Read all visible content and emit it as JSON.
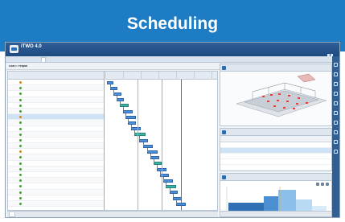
{
  "banner": {
    "title": "Scheduling",
    "color": "#1d7cc3"
  },
  "app": {
    "logo": "iTWO 4.0",
    "subtitle": "",
    "header_right": "",
    "ribbon_tabs": [
      "",
      "",
      "",
      "",
      "",
      "",
      "",
      ""
    ],
    "active_tab_index": 1
  },
  "gantt": {
    "title": "GANTT Fenpild",
    "columns": [
      "",
      "",
      "",
      "",
      ""
    ],
    "rows": [
      {
        "c1": "",
        "c2": "",
        "c3": "",
        "c4": ""
      },
      {
        "c1": "",
        "c2": "",
        "c3": "",
        "c4": ""
      },
      {
        "c1": "",
        "c2": "",
        "c3": "",
        "c4": ""
      },
      {
        "c1": "",
        "c2": "",
        "c3": "",
        "c4": ""
      },
      {
        "c1": "",
        "c2": "",
        "c3": "",
        "c4": ""
      },
      {
        "c1": "",
        "c2": "",
        "c3": "",
        "c4": ""
      },
      {
        "c1": "",
        "c2": "",
        "c3": "",
        "c4": ""
      },
      {
        "c1": "",
        "c2": "",
        "c3": "",
        "c4": ""
      },
      {
        "c1": "",
        "c2": "",
        "c3": "",
        "c4": ""
      },
      {
        "c1": "",
        "c2": "",
        "c3": "",
        "c4": ""
      },
      {
        "c1": "",
        "c2": "",
        "c3": "",
        "c4": ""
      },
      {
        "c1": "",
        "c2": "",
        "c3": "",
        "c4": ""
      },
      {
        "c1": "",
        "c2": "",
        "c3": "",
        "c4": ""
      },
      {
        "c1": "",
        "c2": "",
        "c3": "",
        "c4": ""
      },
      {
        "c1": "",
        "c2": "",
        "c3": "",
        "c4": ""
      },
      {
        "c1": "",
        "c2": "",
        "c3": "",
        "c4": ""
      },
      {
        "c1": "",
        "c2": "",
        "c3": "",
        "c4": ""
      },
      {
        "c1": "",
        "c2": "",
        "c3": "",
        "c4": ""
      },
      {
        "c1": "",
        "c2": "",
        "c3": "",
        "c4": ""
      },
      {
        "c1": "",
        "c2": "",
        "c3": "",
        "c4": ""
      },
      {
        "c1": "",
        "c2": "",
        "c3": "",
        "c4": ""
      },
      {
        "c1": "",
        "c2": "",
        "c3": "",
        "c4": ""
      }
    ],
    "timeline_ticks": [
      "",
      "",
      "",
      "",
      "",
      "",
      ""
    ],
    "bar_labels": [
      "",
      "",
      "",
      "",
      "",
      "",
      "",
      "",
      "",
      "",
      "",
      "",
      "",
      "",
      "",
      "",
      "",
      "",
      ""
    ],
    "bottom_tabs": [
      "",
      ""
    ],
    "today_line_color": "#e8a23a",
    "status_line_color": "#cc4444",
    "bar_color": "#4e8fd6"
  },
  "model_panel": {
    "title": "",
    "callout": "",
    "footer": ""
  },
  "schedule_panel": {
    "title": "",
    "columns": [
      "",
      "",
      ""
    ],
    "rows": [
      {
        "a": "",
        "b": "",
        "c": ""
      },
      {
        "a": "",
        "b": "",
        "c": ""
      },
      {
        "a": "",
        "b": "",
        "c": ""
      },
      {
        "a": "",
        "b": "",
        "c": ""
      },
      {
        "a": "",
        "b": "",
        "c": ""
      },
      {
        "a": "",
        "b": "",
        "c": ""
      }
    ]
  },
  "chart_panel": {
    "title": "",
    "bottom_tabs": [
      "",
      "",
      ""
    ]
  }
}
